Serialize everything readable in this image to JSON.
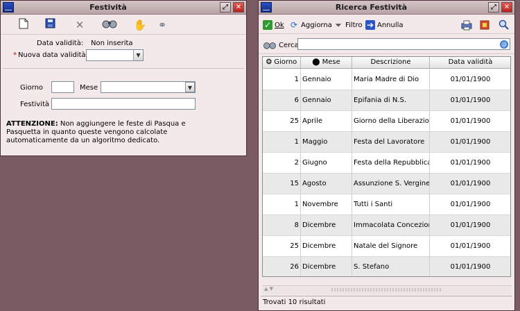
{
  "festivita_window": {
    "title": "Festività",
    "toolbar": [
      "new-icon",
      "save-icon",
      "delete-icon",
      "search-binoculars-icon",
      "hand-icon",
      "link-icon"
    ],
    "data_validita_label": "Data validità:",
    "data_validita_value": "Non inserita",
    "required_marker": "*",
    "nuova_data_label": "Nuova data validità",
    "nuova_data_value": "",
    "giorno_label": "Giorno",
    "giorno_value": "",
    "mese_label": "Mese",
    "mese_value": "",
    "festivita_label": "Festività",
    "festivita_value": "",
    "note_bold": "ATTENZIONE:",
    "note_text": " Non aggiungere le feste di Pasqua e Pasquetta in quanto queste vengono calcolate automaticamente da un algoritmo dedicato."
  },
  "ricerca_window": {
    "title": "Ricerca Festività",
    "toolbar": {
      "ok": "Ok",
      "aggiorna": "Aggiorna",
      "filtro": "Filtro",
      "annulla": "Annulla"
    },
    "search_label": "Cerca",
    "search_value": "",
    "columns": [
      "Giorno",
      "Mese",
      "Descrizione",
      "Data validità"
    ],
    "rows": [
      [
        "1",
        "Gennaio",
        "Maria Madre di Dio",
        "01/01/1900"
      ],
      [
        "6",
        "Gennaio",
        "Epifania di N.S.",
        "01/01/1900"
      ],
      [
        "25",
        "Aprile",
        "Giorno della Liberazione",
        "01/01/1900"
      ],
      [
        "1",
        "Maggio",
        "Festa del Lavoratore",
        "01/01/1900"
      ],
      [
        "2",
        "Giugno",
        "Festa della Repubblica",
        "01/01/1900"
      ],
      [
        "15",
        "Agosto",
        "Assunzione S. Vergine",
        "01/01/1900"
      ],
      [
        "1",
        "Novembre",
        "Tutti i Santi",
        "01/01/1900"
      ],
      [
        "8",
        "Dicembre",
        "Immacolata Concezione",
        "01/01/1900"
      ],
      [
        "25",
        "Dicembre",
        "Natale del Signore",
        "01/01/1900"
      ],
      [
        "26",
        "Dicembre",
        "S. Stefano",
        "01/01/1900"
      ]
    ],
    "status": "Trovati 10 risultati"
  },
  "colors": {
    "desktop": "#7a5a62",
    "window_bg": "#f4e9e9",
    "close_button": "#c8342c",
    "required": "#d00000",
    "ok_green": "#2f9a2f"
  }
}
